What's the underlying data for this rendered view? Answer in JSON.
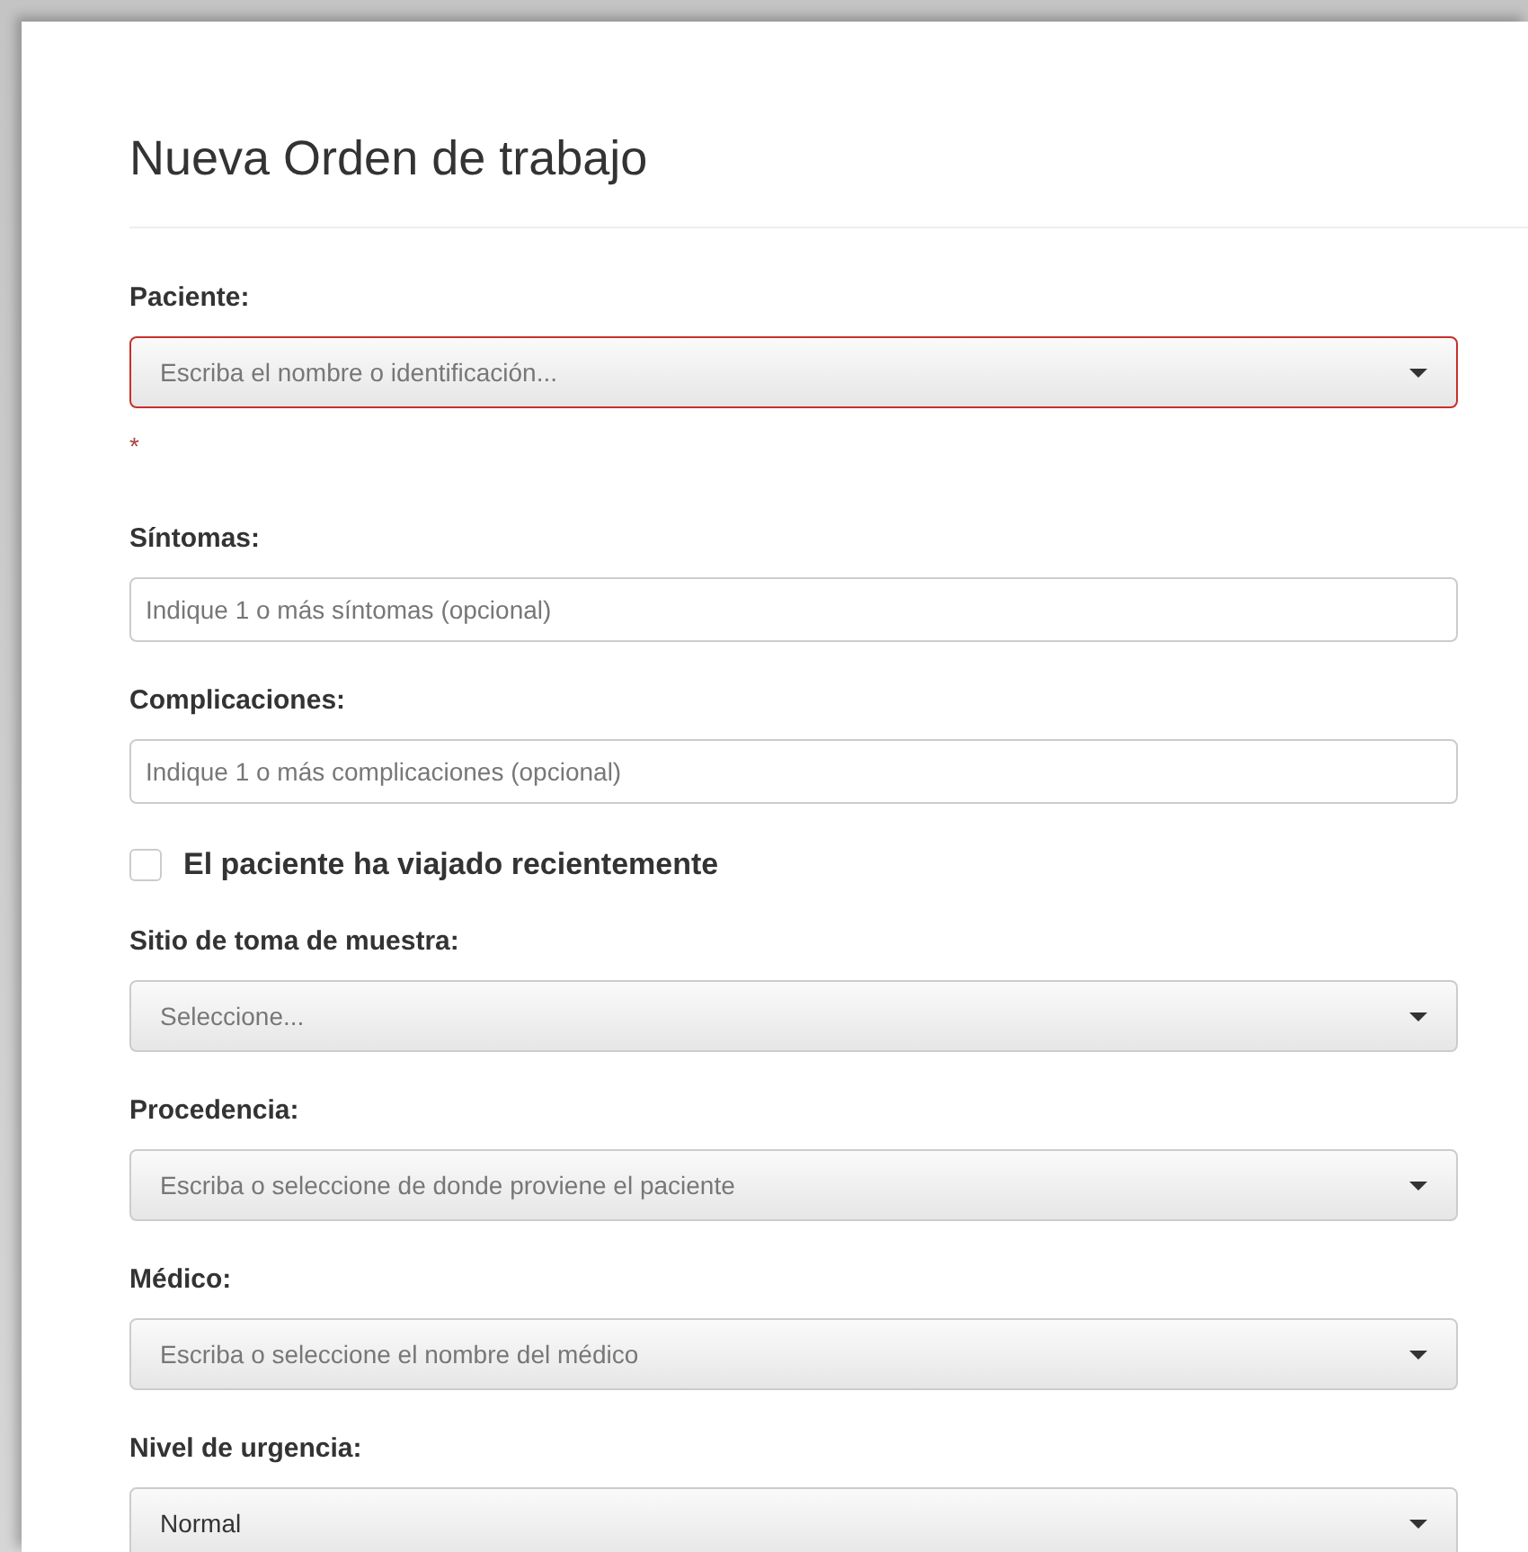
{
  "title": "Nueva Orden de trabajo",
  "fields": [
    {
      "kind": "select",
      "label": "Paciente:",
      "placeholder": "Escriba el nombre o identificación...",
      "invalid": true,
      "error_text": "*"
    },
    {
      "kind": "text",
      "label": "Síntomas:",
      "placeholder": "Indique 1 o más síntomas (opcional)"
    },
    {
      "kind": "text",
      "label": "Complicaciones:",
      "placeholder": "Indique 1 o más complicaciones (opcional)"
    },
    {
      "kind": "checkbox",
      "label": "El paciente ha viajado recientemente",
      "checked": false
    },
    {
      "kind": "select",
      "label": "Sitio de toma de muestra:",
      "placeholder": "Seleccione...",
      "invalid": false
    },
    {
      "kind": "select",
      "label": "Procedencia:",
      "placeholder": "Escriba o seleccione de donde proviene el paciente",
      "invalid": false
    },
    {
      "kind": "select",
      "label": "Médico:",
      "placeholder": "Escriba o seleccione el nombre del médico",
      "invalid": false
    },
    {
      "kind": "select",
      "label": "Nivel de urgencia:",
      "value": "Normal",
      "invalid": false
    }
  ]
}
